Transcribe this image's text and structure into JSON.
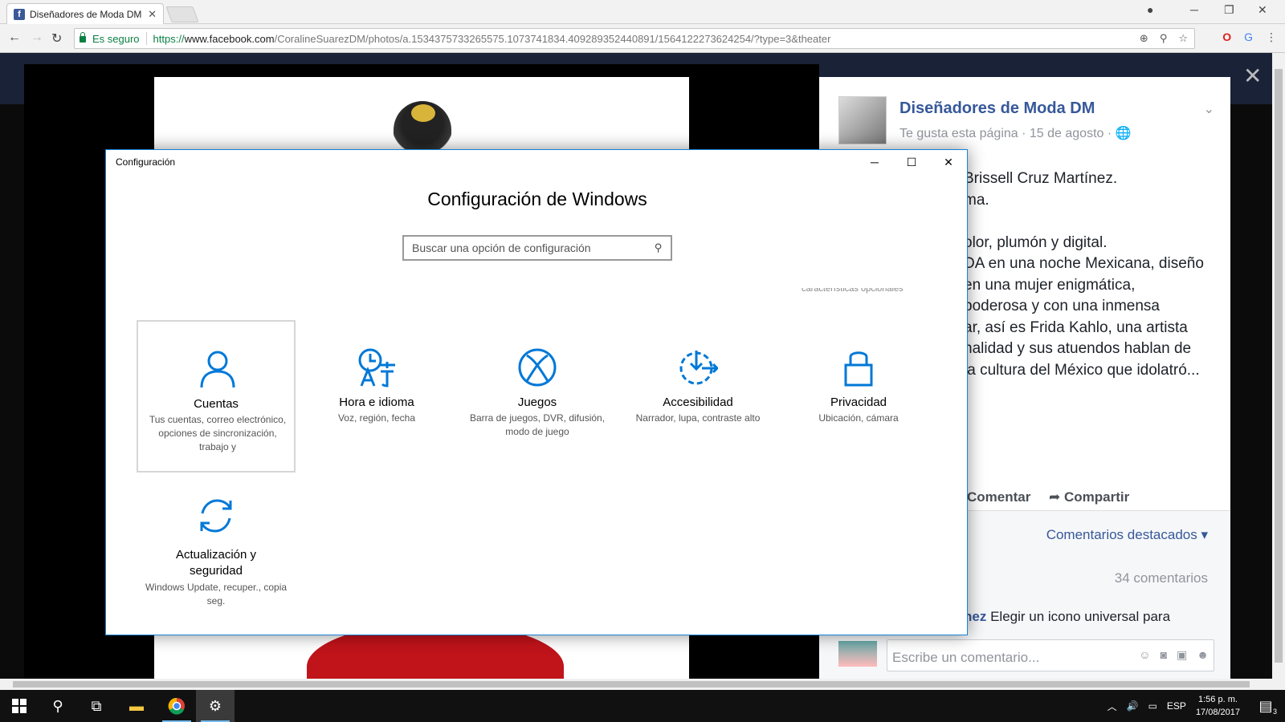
{
  "browser": {
    "tab_title": "Diseñadores de Moda DM",
    "tab_favicon": "f",
    "secure_label": "Es seguro",
    "url_scheme": "https://",
    "url_host": "www.facebook.com",
    "url_path": "/CoralineSuarezDM/photos/a.1534375733265575.1073741834.409289352440891/1564122273624254/?type=3&theater"
  },
  "facebook": {
    "page_name": "Diseñadores de Moda DM",
    "page_meta": "Te gusta esta página · 15 de agosto · ",
    "post_lines": [
      "Brissell Cruz Martínez.",
      "ma.",
      "",
      "olor, plumón y digital.",
      "DA en una noche Mexicana, diseño",
      "en una mujer enigmática,",
      "poderosa y con una inmensa",
      "ar, así es Frida Kahlo, una artista",
      "nalidad y sus atuendos hablan de",
      "la cultura del México que idolatró..."
    ],
    "comment_action": "Comentar",
    "share_action": "Compartir",
    "featured_comments": "Comentarios destacados",
    "comment_count": "34 comentarios",
    "comment_author_fragment": "hez",
    "comment_text": "Elegir un icono universal para",
    "comment_placeholder": "Escribe un comentario..."
  },
  "settings": {
    "window_title": "Configuración",
    "heading": "Configuración de Windows",
    "search_placeholder": "Buscar una opción de configuración",
    "ghost_text": "características opcionales",
    "accent": "#0078d7",
    "tiles": [
      {
        "label": "Cuentas",
        "desc": "Tus cuentas, correo electrónico, opciones de sincronización, trabajo y",
        "icon": "person-icon",
        "selected": true
      },
      {
        "label": "Hora e idioma",
        "desc": "Voz, región, fecha",
        "icon": "time-language-icon"
      },
      {
        "label": "Juegos",
        "desc": "Barra de juegos, DVR, difusión, modo de juego",
        "icon": "xbox-icon"
      },
      {
        "label": "Accesibilidad",
        "desc": "Narrador, lupa, contraste alto",
        "icon": "ease-of-access-icon"
      },
      {
        "label": "Privacidad",
        "desc": "Ubicación, cámara",
        "icon": "lock-icon"
      },
      {
        "label": "Actualización y seguridad",
        "desc": "Windows Update, recuper., copia seg.",
        "icon": "update-icon"
      }
    ]
  },
  "taskbar": {
    "language": "ESP",
    "time": "1:56 p. m.",
    "date": "17/08/2017",
    "notifications": "3"
  }
}
